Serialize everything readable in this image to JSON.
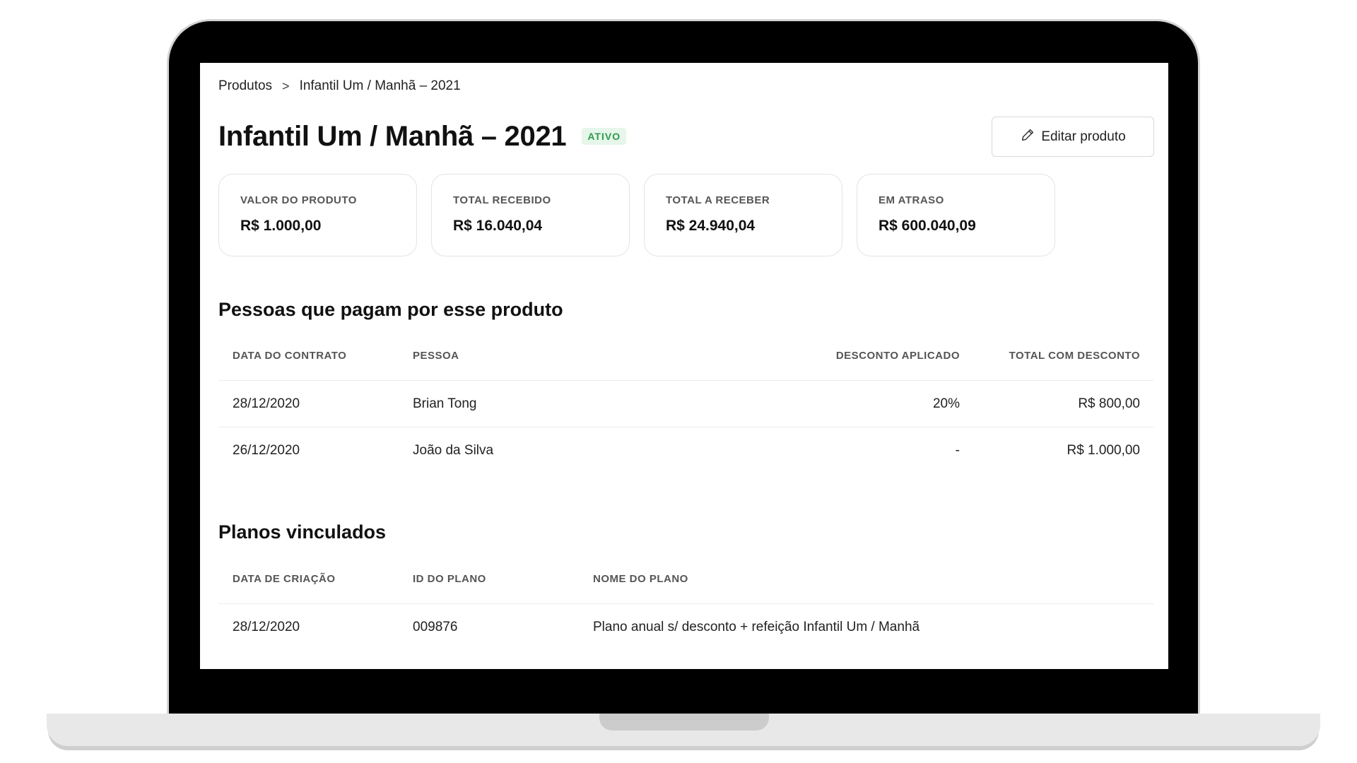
{
  "breadcrumb": {
    "items": [
      "Produtos",
      "Infantil Um / Manhã – 2021"
    ],
    "separator": ">"
  },
  "header": {
    "title": "Infantil Um / Manhã – 2021",
    "status": "ATIVO",
    "edit_label": "Editar produto"
  },
  "cards": [
    {
      "label": "VALOR DO PRODUTO",
      "value": "R$ 1.000,00"
    },
    {
      "label": "TOTAL RECEBIDO",
      "value": "R$ 16.040,04"
    },
    {
      "label": "TOTAL A RECEBER",
      "value": "R$ 24.940,04"
    },
    {
      "label": "EM ATRASO",
      "value": "R$ 600.040,09"
    }
  ],
  "payers": {
    "title": "Pessoas que pagam por esse produto",
    "columns": [
      "DATA DO CONTRATO",
      "PESSOA",
      "DESCONTO APLICADO",
      "TOTAL COM DESCONTO"
    ],
    "rows": [
      [
        "28/12/2020",
        "Brian Tong",
        "20%",
        "R$ 800,00"
      ],
      [
        "26/12/2020",
        "João da Silva",
        "-",
        "R$ 1.000,00"
      ]
    ]
  },
  "plans": {
    "title": "Planos vinculados",
    "columns": [
      "DATA DE CRIAÇÃO",
      "ID DO PLANO",
      "NOME DO PLANO"
    ],
    "rows": [
      [
        "28/12/2020",
        "009876",
        "Plano anual s/ desconto + refeição Infantil Um / Manhã"
      ]
    ]
  },
  "colors": {
    "badge_bg": "#e6f6ea",
    "badge_text": "#2f9a4d",
    "border": "#e4e4e4"
  },
  "icons": {
    "edit": "pencil-icon",
    "breadcrumb_separator": "chevron-right-icon"
  }
}
